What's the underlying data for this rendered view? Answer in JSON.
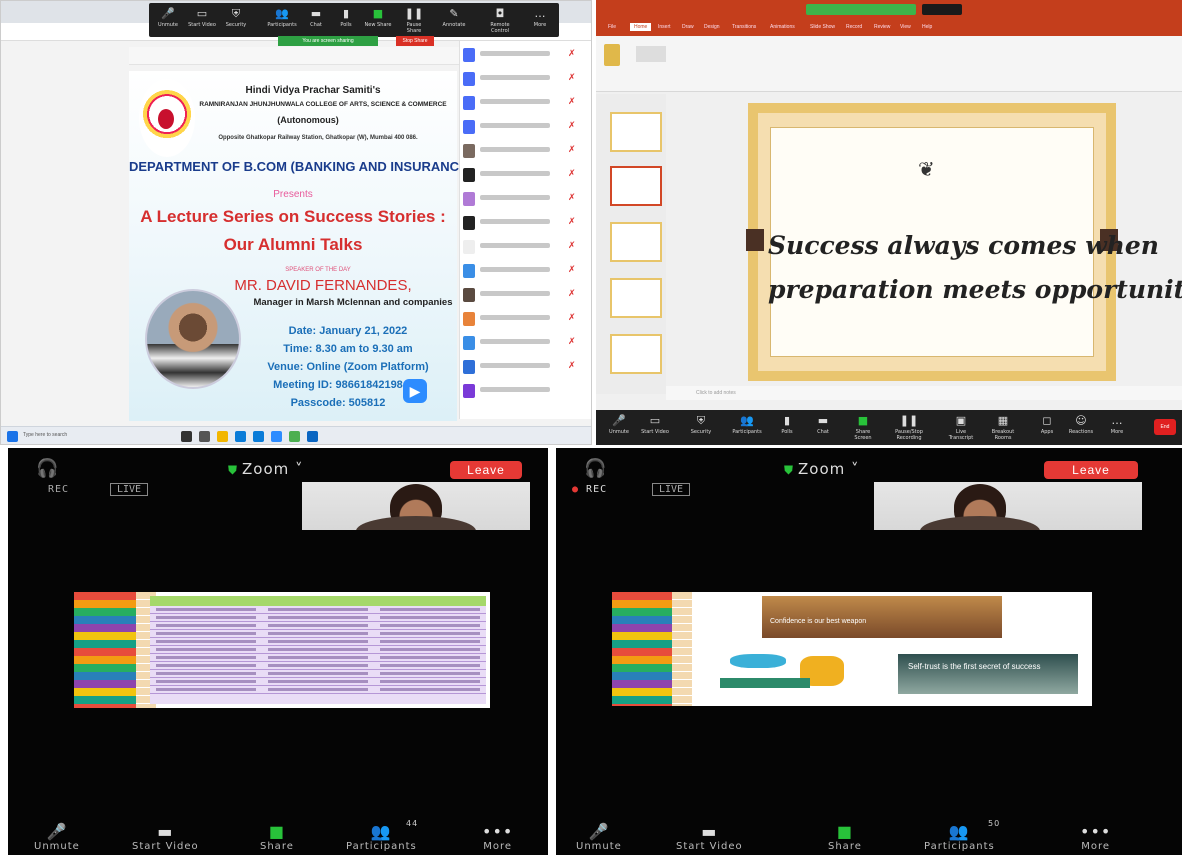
{
  "top_left": {
    "zoom_toolbar": [
      "Unmute",
      "Start Video",
      "Security",
      "Participants",
      "Chat",
      "Polls",
      "New Share",
      "Pause Share",
      "Annotate",
      "Remote Control",
      "More"
    ],
    "sharing_flag": "You are screen sharing",
    "stop_share": "Stop Share",
    "poster": {
      "org": "Hindi Vidya Prachar Samiti's",
      "college": "RAMNIRANJAN JHUNJHUNWALA COLLEGE OF ARTS, SCIENCE & COMMERCE",
      "autonomous": "(Autonomous)",
      "address": "Opposite Ghatkopar Railway Station, Ghatkopar (W), Mumbai 400 086.",
      "department": "DEPARTMENT OF B.COM (BANKING AND INSURANCE)",
      "presents": "Presents",
      "title_line1": "A Lecture Series on Success Stories :",
      "title_line2": "Our Alumni Talks",
      "speaker_label": "SPEAKER OF THE DAY",
      "speaker_name": "MR. DAVID FERNANDES,",
      "speaker_role": "Manager in Marsh Mclennan and companies",
      "date": "Date: January 21, 2022",
      "time": "Time: 8.30 am to 9.30 am",
      "venue": "Venue: Online (Zoom Platform)",
      "meeting_id": "Meeting ID: 98661842198",
      "passcode": "Passcode: 505812"
    },
    "taskbar_search": "Type here to search"
  },
  "top_right": {
    "ribbon_tabs": [
      "File",
      "Home",
      "Insert",
      "Draw",
      "Design",
      "Transitions",
      "Animations",
      "Slide Show",
      "Record",
      "Review",
      "View",
      "Help"
    ],
    "slide_quote_line1": "Success always comes when",
    "slide_quote_line2": "preparation meets opportunity!!",
    "notes_placeholder": "Click to add notes",
    "zoom_toolbar": [
      "Unmute",
      "Start Video",
      "Security",
      "Participants",
      "Polls",
      "Chat",
      "Share Screen",
      "Pause/Stop Recording",
      "Live Transcript",
      "Breakout Rooms",
      "Apps",
      "Reactions",
      "More"
    ],
    "end_label": "End"
  },
  "phone_left": {
    "zoom": "Zoom",
    "leave": "Leave",
    "rec": "REC",
    "live": "LIVE",
    "controls": [
      "Unmute",
      "Start Video",
      "Share",
      "Participants",
      "More"
    ],
    "participant_count": "44"
  },
  "phone_right": {
    "zoom": "Zoom",
    "leave": "Leave",
    "rec": "REC",
    "live": "LIVE",
    "slide_text1": "Confidence is our best weapon",
    "slide_text2": "Self-trust is the first secret of success",
    "controls": [
      "Unmute",
      "Start Video",
      "Share",
      "Participants",
      "More"
    ],
    "participant_count": "50"
  }
}
